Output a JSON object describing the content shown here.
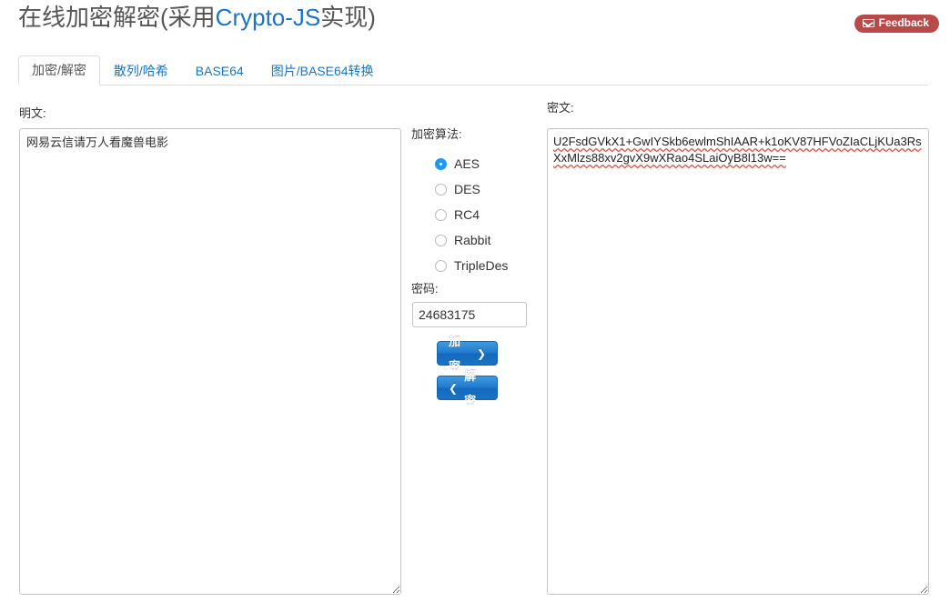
{
  "header": {
    "title_prefix": "在线加密解密(采用",
    "title_link": "Crypto-JS",
    "title_suffix": "实现)",
    "feedback_label": "Feedback",
    "feedback_icon": "envelope-icon",
    "feedback_color": "#b84a4a",
    "link_color": "#1a74c6"
  },
  "tabs": [
    {
      "label": "加密/解密",
      "active": true
    },
    {
      "label": "散列/哈希",
      "active": false
    },
    {
      "label": "BASE64",
      "active": false
    },
    {
      "label": "图片/BASE64转换",
      "active": false
    }
  ],
  "plaintext": {
    "label": "明文:",
    "value": "网易云信请万人看魔兽电影",
    "placeholder": ""
  },
  "ciphertext": {
    "label": "密文:",
    "value": "U2FsdGVkX1+GwIYSkb6ewlmShIAAR+k1oKV87HFVoZIaCLjKUa3RsXxMlzs88xv2gvX9wXRao4SLaiOyB8l13w==",
    "placeholder": "",
    "spellcheck_underline_color": "#e8503a"
  },
  "algorithm": {
    "label": "加密算法:",
    "selected": "AES",
    "accent_color": "#2196f3",
    "options": [
      {
        "label": "AES",
        "checked": true
      },
      {
        "label": "DES",
        "checked": false
      },
      {
        "label": "RC4",
        "checked": false
      },
      {
        "label": "Rabbit",
        "checked": false
      },
      {
        "label": "TripleDes",
        "checked": false
      }
    ]
  },
  "password": {
    "label": "密码:",
    "value": "24683175",
    "placeholder": ""
  },
  "actions": {
    "encrypt_label": "加密",
    "encrypt_icon": "chevron-right-icon",
    "decrypt_label": "解密",
    "decrypt_icon": "chevron-left-icon",
    "button_color": "#1f79cc"
  },
  "glyphs": {
    "chevron_right": "❯",
    "chevron_left": "❮"
  }
}
